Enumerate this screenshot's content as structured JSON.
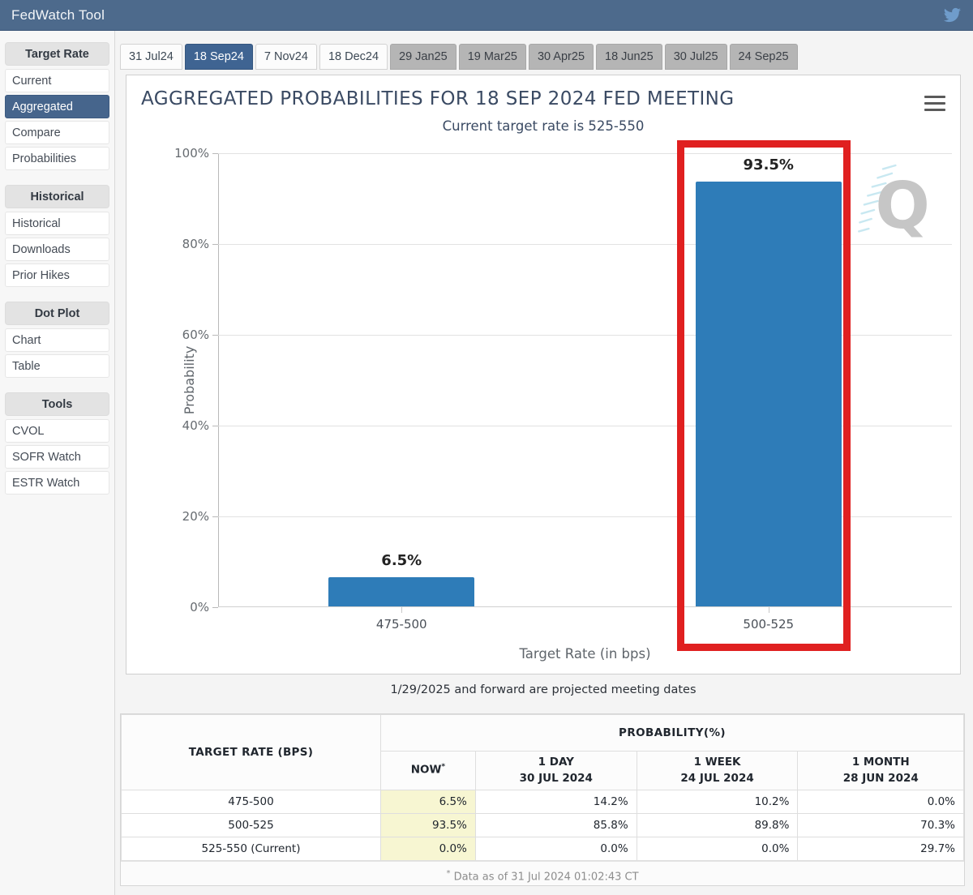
{
  "header": {
    "title": "FedWatch Tool",
    "twitter_icon": "twitter-bird-icon",
    "bar_color": "#4d6a8c"
  },
  "sidebar": {
    "groups": [
      {
        "title": "Target Rate",
        "items": [
          {
            "label": "Current",
            "active": false
          },
          {
            "label": "Aggregated",
            "active": true
          },
          {
            "label": "Compare",
            "active": false
          },
          {
            "label": "Probabilities",
            "active": false
          }
        ]
      },
      {
        "title": "Historical",
        "items": [
          {
            "label": "Historical",
            "active": false
          },
          {
            "label": "Downloads",
            "active": false
          },
          {
            "label": "Prior Hikes",
            "active": false
          }
        ]
      },
      {
        "title": "Dot Plot",
        "items": [
          {
            "label": "Chart",
            "active": false
          },
          {
            "label": "Table",
            "active": false
          }
        ]
      },
      {
        "title": "Tools",
        "items": [
          {
            "label": "CVOL",
            "active": false
          },
          {
            "label": "SOFR Watch",
            "active": false
          },
          {
            "label": "ESTR Watch",
            "active": false
          }
        ]
      }
    ]
  },
  "tabs": [
    {
      "label": "31 Jul24",
      "state": "normal"
    },
    {
      "label": "18 Sep24",
      "state": "active"
    },
    {
      "label": "7 Nov24",
      "state": "normal"
    },
    {
      "label": "18 Dec24",
      "state": "normal"
    },
    {
      "label": "29 Jan25",
      "state": "dim"
    },
    {
      "label": "19 Mar25",
      "state": "dim"
    },
    {
      "label": "30 Apr25",
      "state": "dim"
    },
    {
      "label": "18 Jun25",
      "state": "dim"
    },
    {
      "label": "30 Jul25",
      "state": "dim"
    },
    {
      "label": "24 Sep25",
      "state": "dim"
    }
  ],
  "chart_card": {
    "menu_icon": "hamburger-menu-icon",
    "watermark": "q-logo-watermark",
    "projected_note": "1/29/2025 and forward are projected meeting dates"
  },
  "chart_data": {
    "type": "bar",
    "title": "AGGREGATED PROBABILITIES FOR 18 SEP 2024 FED MEETING",
    "subtitle": "Current target rate is 525-550",
    "categories": [
      "475-500",
      "500-525"
    ],
    "values": [
      6.5,
      93.5
    ],
    "value_labels": [
      "6.5%",
      "93.5%"
    ],
    "xlabel": "Target Rate (in bps)",
    "ylabel": "Probability",
    "ylim": [
      0,
      100
    ],
    "yticks": [
      0,
      20,
      40,
      60,
      80,
      100
    ],
    "ytick_labels": [
      "0%",
      "20%",
      "40%",
      "60%",
      "80%",
      "100%"
    ],
    "grid": true,
    "legend": "none",
    "bar_color": "#2e7cb8",
    "highlight": {
      "category": "500-525",
      "color": "#e02020",
      "label": "red-annotation-rectangle"
    }
  },
  "table": {
    "col_target": "TARGET RATE (BPS)",
    "group_header": "PROBABILITY(%)",
    "columns": [
      {
        "top": "NOW",
        "sub": "",
        "star": true
      },
      {
        "top": "1 DAY",
        "sub": "30 JUL 2024",
        "star": false
      },
      {
        "top": "1 WEEK",
        "sub": "24 JUL 2024",
        "star": false
      },
      {
        "top": "1 MONTH",
        "sub": "28 JUN 2024",
        "star": false
      }
    ],
    "rows": [
      {
        "rate": "475-500",
        "now": "6.5%",
        "day": "14.2%",
        "week": "10.2%",
        "month": "0.0%"
      },
      {
        "rate": "500-525",
        "now": "93.5%",
        "day": "85.8%",
        "week": "89.8%",
        "month": "70.3%"
      },
      {
        "rate": "525-550 (Current)",
        "now": "0.0%",
        "day": "0.0%",
        "week": "0.0%",
        "month": "29.7%"
      }
    ],
    "footnote": "Data as of 31 Jul 2024 01:02:43 CT",
    "footnote_star": "*",
    "now_highlight_color": "#f7f6d2"
  }
}
